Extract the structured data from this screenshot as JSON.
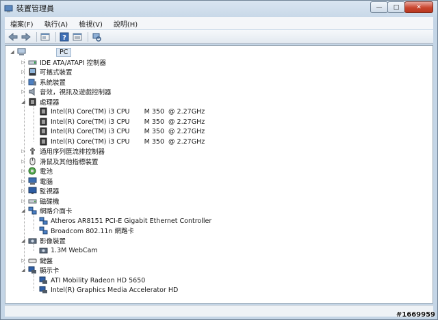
{
  "window": {
    "title": "裝置管理員",
    "buttons": {
      "minimize": "—",
      "maximize": "□",
      "close": "✕"
    }
  },
  "menu": [
    "檔案(F)",
    "執行(A)",
    "檢視(V)",
    "說明(H)"
  ],
  "toolbar": {
    "icons": [
      "back-arrow-icon",
      "forward-arrow-icon",
      "properties-icon",
      "help-icon",
      "view-icon",
      "scan-hardware-icon"
    ]
  },
  "tree": {
    "root": "PC",
    "categories": {
      "ide": "IDE ATA/ATAPI 控制器",
      "portable": "可攜式裝置",
      "system": "系統裝置",
      "sound": "音效，視訊及遊戲控制器",
      "processors": "處理器",
      "usb": "通用序列匯流排控制器",
      "mouse": "滑鼠及其他指標裝置",
      "battery": "電池",
      "computer": "電腦",
      "monitor": "監視器",
      "disk": "磁碟機",
      "network": "網路介面卡",
      "imaging": "影像裝置",
      "keyboard": "鍵盤",
      "display": "顯示卡"
    },
    "cpu": [
      "Intel(R) Core(TM) i3 CPU       M 350  @ 2.27GHz",
      "Intel(R) Core(TM) i3 CPU       M 350  @ 2.27GHz",
      "Intel(R) Core(TM) i3 CPU       M 350  @ 2.27GHz",
      "Intel(R) Core(TM) i3 CPU       M 350  @ 2.27GHz"
    ],
    "network_devices": [
      "Atheros AR8151 PCI-E Gigabit Ethernet Controller",
      "Broadcom 802.11n 網路卡"
    ],
    "imaging_devices": [
      "1.3M WebCam"
    ],
    "display_devices": [
      "ATI Mobility Radeon HD 5650",
      "Intel(R) Graphics Media Accelerator HD"
    ]
  },
  "watermark": "#1669959",
  "colors": {
    "close": "#c9462f",
    "selection": "#dce7f3"
  }
}
